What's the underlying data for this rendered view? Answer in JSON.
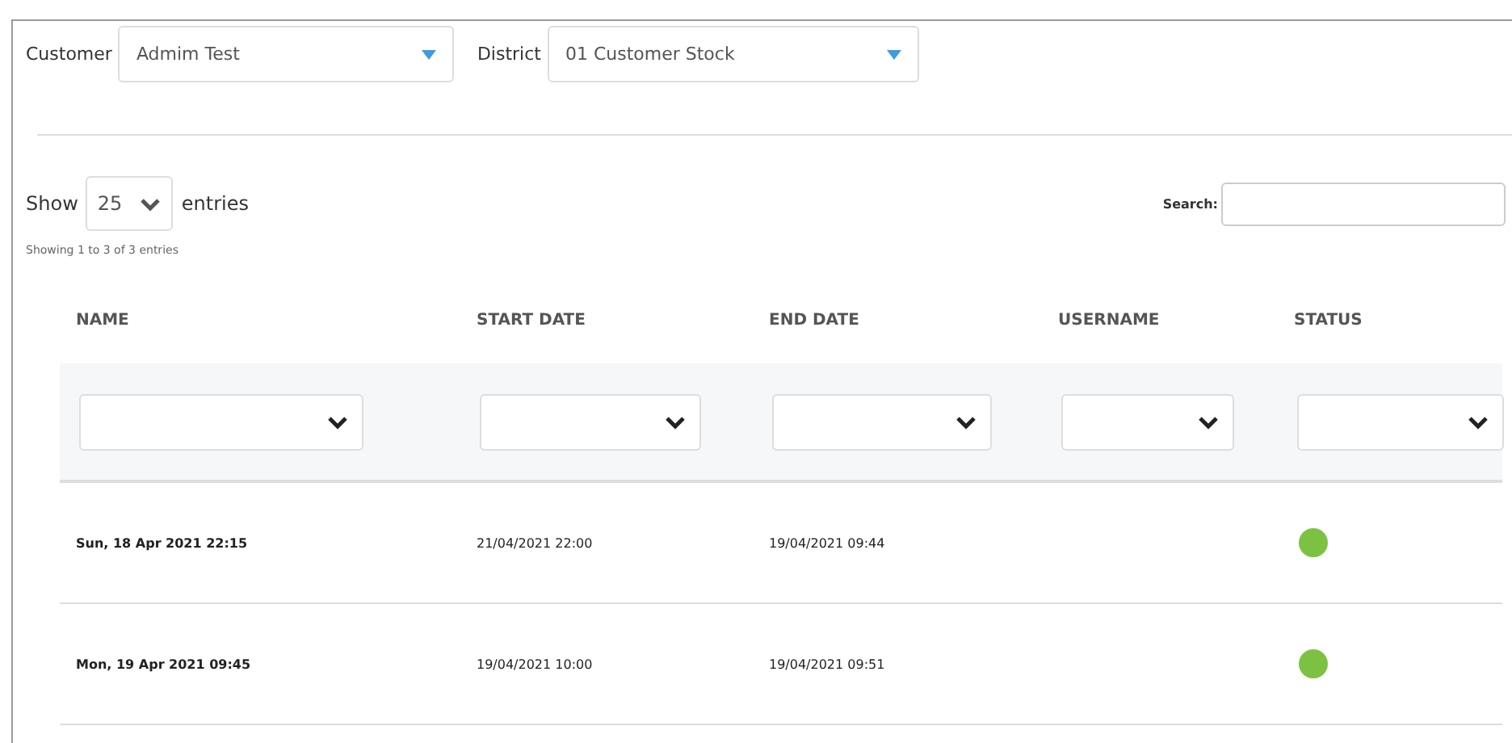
{
  "filters": [
    {
      "label": "Customer",
      "value": "Admim Test"
    },
    {
      "label": "District",
      "value": "01 Customer Stock"
    }
  ],
  "length": {
    "show": "Show",
    "value": "25",
    "entries": "entries"
  },
  "search": {
    "label": "Search:"
  },
  "info": "Showing 1 to 3 of 3 entries",
  "table": {
    "columns": [
      "NAME",
      "START DATE",
      "END DATE",
      "USERNAME",
      "STATUS"
    ],
    "rows": [
      {
        "name": "Sun, 18 Apr 2021 22:15",
        "start": "21/04/2021 22:00",
        "end": "19/04/2021 09:44",
        "color": "#7dc143"
      },
      {
        "name": "Mon, 19 Apr 2021 09:45",
        "start": "19/04/2021 10:00",
        "end": "19/04/2021 09:51",
        "color": "#7dc143"
      }
    ]
  }
}
